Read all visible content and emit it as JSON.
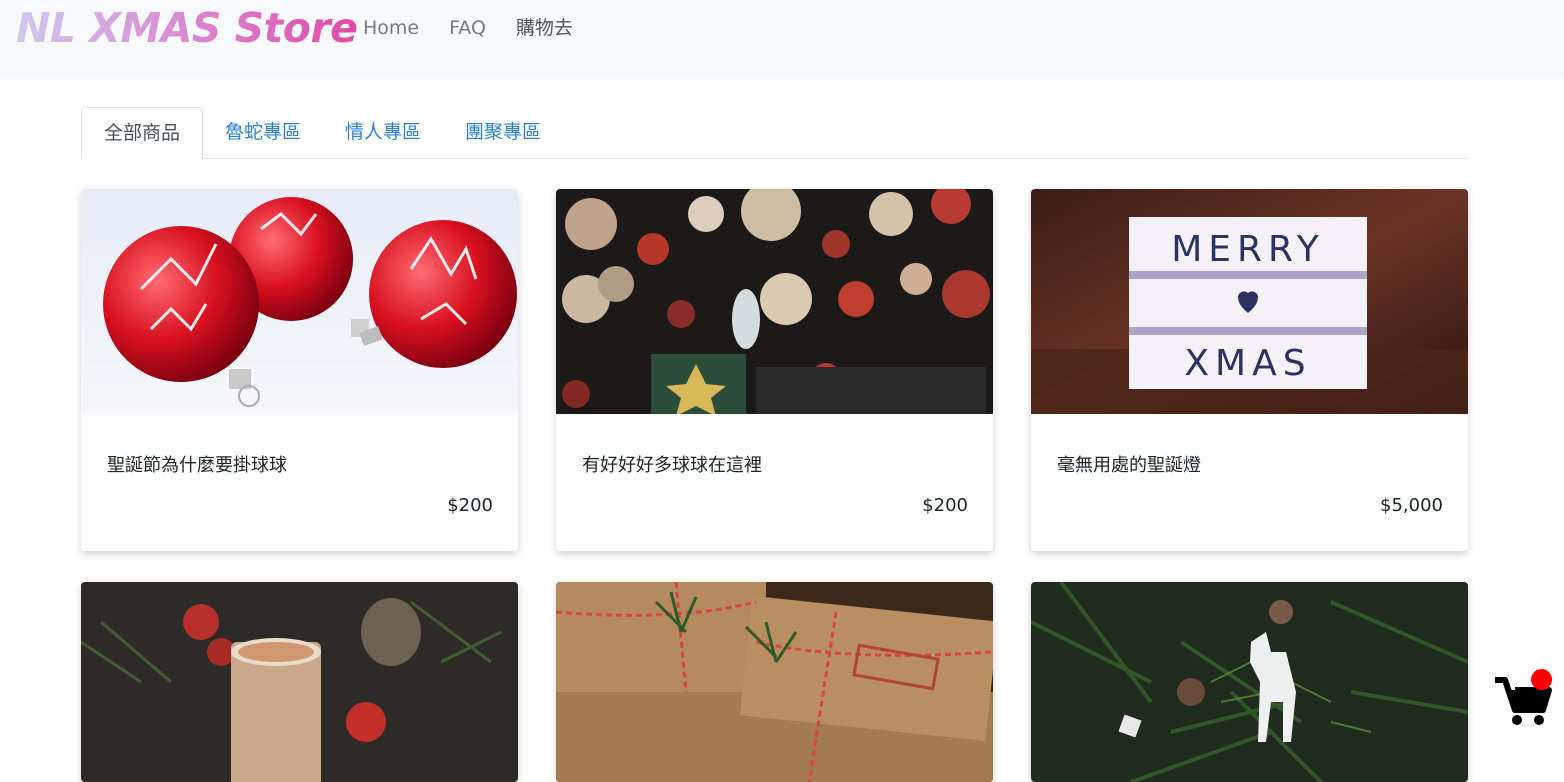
{
  "brand": "NL XMAS Store",
  "nav": [
    "Home",
    "FAQ",
    "購物去"
  ],
  "tabs": [
    "全部商品",
    "魯蛇專區",
    "情人專區",
    "團聚專區"
  ],
  "products": [
    {
      "title": "聖誕節為什麼要掛球球",
      "price": "$200"
    },
    {
      "title": "有好好好多球球在這裡",
      "price": "$200"
    },
    {
      "title": "毫無用處的聖誕燈",
      "price": "$5,000"
    }
  ],
  "lightbox_text": {
    "line1": "MERRY",
    "line3": "XMAS"
  },
  "colors": {
    "accent": "#2f80d1",
    "cart_badge": "#ff0000"
  }
}
